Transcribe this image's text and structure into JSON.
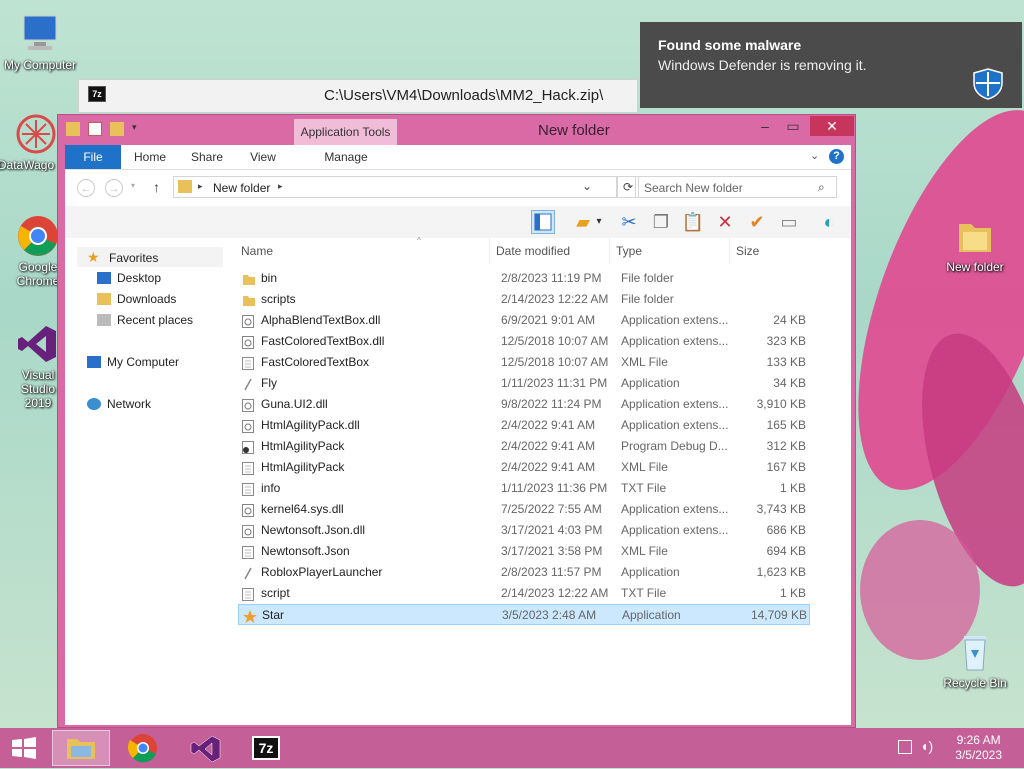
{
  "desktop": {
    "icons": [
      {
        "label": "My Computer"
      },
      {
        "label": "DataWago"
      },
      {
        "label": "Google Chrome"
      },
      {
        "label": "Visual Studio 2019"
      },
      {
        "label": "New folder"
      },
      {
        "label": "Recycle Bin"
      }
    ]
  },
  "zip_window": {
    "title": "C:\\Users\\VM4\\Downloads\\MM2_Hack.zip\\",
    "icon_text": "7z"
  },
  "toast": {
    "heading": "Found some malware",
    "body": "Windows Defender is removing it."
  },
  "explorer": {
    "title": "New folder",
    "app_tools": "Application Tools",
    "tabs": [
      "File",
      "Home",
      "Share",
      "View",
      "Manage"
    ],
    "address": "New folder",
    "search_placeholder": "Search New folder",
    "nav": {
      "favorites": "Favorites",
      "desktop": "Desktop",
      "downloads": "Downloads",
      "recent": "Recent places",
      "computer": "My Computer",
      "network": "Network"
    },
    "columns": [
      "Name",
      "Date modified",
      "Type",
      "Size"
    ],
    "files": [
      {
        "name": "bin",
        "date": "2/8/2023 11:19 PM",
        "type": "File folder",
        "size": "",
        "kind": "folder"
      },
      {
        "name": "scripts",
        "date": "2/14/2023 12:22 AM",
        "type": "File folder",
        "size": "",
        "kind": "folder"
      },
      {
        "name": "AlphaBlendTextBox.dll",
        "date": "6/9/2021 9:01 AM",
        "type": "Application extens...",
        "size": "24 KB",
        "kind": "dll"
      },
      {
        "name": "FastColoredTextBox.dll",
        "date": "12/5/2018 10:07 AM",
        "type": "Application extens...",
        "size": "323 KB",
        "kind": "dll"
      },
      {
        "name": "FastColoredTextBox",
        "date": "12/5/2018 10:07 AM",
        "type": "XML File",
        "size": "133 KB",
        "kind": "doc"
      },
      {
        "name": "Fly",
        "date": "1/11/2023 11:31 PM",
        "type": "Application",
        "size": "34 KB",
        "kind": "app"
      },
      {
        "name": "Guna.UI2.dll",
        "date": "9/8/2022 11:24 PM",
        "type": "Application extens...",
        "size": "3,910 KB",
        "kind": "dll"
      },
      {
        "name": "HtmlAgilityPack.dll",
        "date": "2/4/2022 9:41 AM",
        "type": "Application extens...",
        "size": "165 KB",
        "kind": "dll"
      },
      {
        "name": "HtmlAgilityPack",
        "date": "2/4/2022 9:41 AM",
        "type": "Program Debug D...",
        "size": "312 KB",
        "kind": "pdb"
      },
      {
        "name": "HtmlAgilityPack",
        "date": "2/4/2022 9:41 AM",
        "type": "XML File",
        "size": "167 KB",
        "kind": "doc"
      },
      {
        "name": "info",
        "date": "1/11/2023 11:36 PM",
        "type": "TXT File",
        "size": "1 KB",
        "kind": "doc"
      },
      {
        "name": "kernel64.sys.dll",
        "date": "7/25/2022 7:55 AM",
        "type": "Application extens...",
        "size": "3,743 KB",
        "kind": "dll"
      },
      {
        "name": "Newtonsoft.Json.dll",
        "date": "3/17/2021 4:03 PM",
        "type": "Application extens...",
        "size": "686 KB",
        "kind": "dll"
      },
      {
        "name": "Newtonsoft.Json",
        "date": "3/17/2021 3:58 PM",
        "type": "XML File",
        "size": "694 KB",
        "kind": "doc"
      },
      {
        "name": "RobloxPlayerLauncher",
        "date": "2/8/2023 11:57 PM",
        "type": "Application",
        "size": "1,623 KB",
        "kind": "app"
      },
      {
        "name": "script",
        "date": "2/14/2023 12:22 AM",
        "type": "TXT File",
        "size": "1 KB",
        "kind": "doc"
      },
      {
        "name": "Star",
        "date": "3/5/2023 2:48 AM",
        "type": "Application",
        "size": "14,709 KB",
        "kind": "star",
        "selected": true
      }
    ]
  },
  "taskbar": {
    "time": "9:26 AM",
    "date": "3/5/2023",
    "app_7z": "7z"
  }
}
